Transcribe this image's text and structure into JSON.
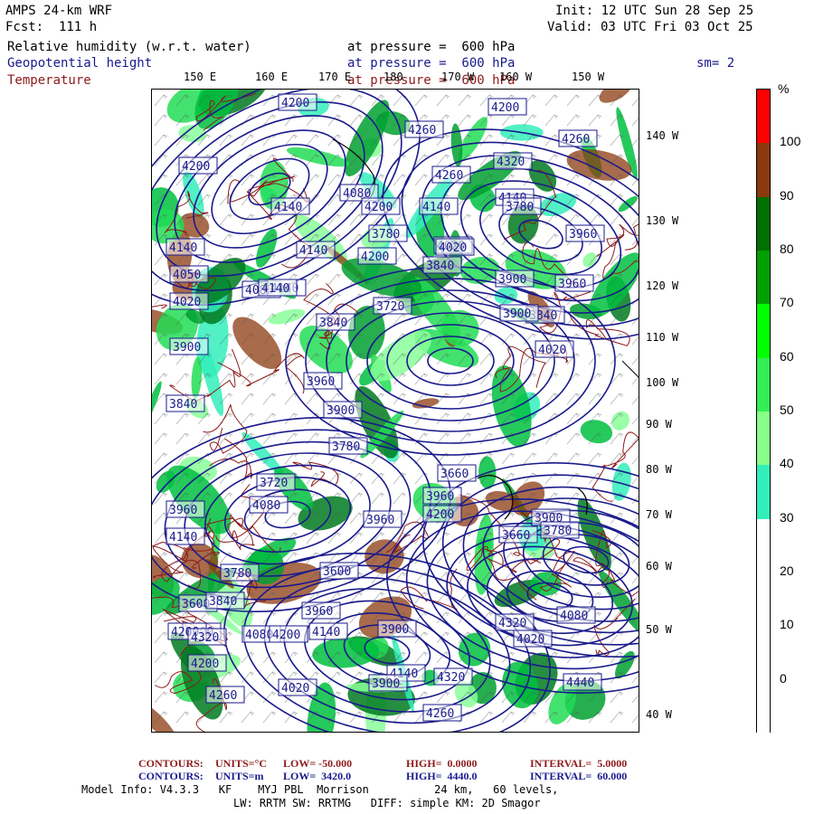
{
  "header": {
    "model": "AMPS 24-km WRF",
    "fcst": "Fcst:  111 h",
    "init": "Init: 12 UTC Sun 28 Sep 25",
    "valid": "Valid: 03 UTC Fri 03 Oct 25",
    "fields": [
      {
        "name": "Relative humidity (w.r.t. water)",
        "level": "at pressure =  600 hPa",
        "color": "#000000"
      },
      {
        "name": "Geopotential height",
        "level": "at pressure =  600 hPa",
        "color": "#1a1a8c"
      },
      {
        "name": "Temperature",
        "level": "at pressure =  600 hPa",
        "color": "#8c1a1a"
      }
    ],
    "smooth": "sm= 2"
  },
  "map": {
    "lon_labels": [
      "150 E",
      "160 E",
      "170 E",
      "180",
      "170 W",
      "160 W",
      "150 W"
    ],
    "lat_labels": [
      "140 W",
      "130 W",
      "120 W",
      "110 W",
      "100 W",
      "90 W",
      "80 W",
      "70 W",
      "60 W",
      "50 W",
      "40 W"
    ],
    "height_labels": [
      "4200",
      "4260",
      "4200",
      "4260",
      "4200",
      "4080",
      "4260",
      "4320",
      "4140",
      "4200",
      "4140",
      "4140",
      "3960",
      "4050",
      "4200",
      "3780",
      "4020",
      "4080",
      "3780",
      "3840",
      "4140",
      "4140",
      "4140",
      "3900",
      "3960",
      "4020",
      "3840",
      "3900",
      "4140",
      "4020",
      "3720",
      "3900",
      "4020",
      "3840",
      "3960",
      "3840",
      "3900",
      "3720",
      "3780",
      "3660",
      "3960",
      "3960",
      "4080",
      "4140",
      "3600",
      "3960",
      "3660",
      "3600",
      "3780",
      "3900",
      "3780",
      "4200",
      "3840",
      "4080",
      "4320",
      "4020",
      "3900",
      "4200",
      "4140",
      "4020",
      "3900",
      "3960",
      "4200",
      "4200",
      "4260",
      "4320",
      "4260",
      "4200",
      "4320",
      "4140",
      "4080",
      "4440"
    ]
  },
  "colorbar": {
    "unit": "%",
    "ticks": [
      "100",
      "90",
      "80",
      "70",
      "60",
      "50",
      "40",
      "30",
      "20",
      "10",
      "0"
    ],
    "colors": [
      "#ff0000",
      "#8b3a0f",
      "#007000",
      "#00a000",
      "#00ff00",
      "#33ee55",
      "#88ff88",
      "#33eebb",
      "#ffffff",
      "#ffffff",
      "#ffffff",
      "#ffffff"
    ]
  },
  "footer": {
    "line1": {
      "label": "CONTOURS:",
      "units": "UNITS=°C",
      "low": "LOW= -50.000",
      "high": "HIGH=  0.0000",
      "interval": "INTERVAL=  5.0000"
    },
    "line2": {
      "label": "CONTOURS:",
      "units": "UNITS=m",
      "low": "LOW=  3420.0",
      "high": "HIGH=  4440.0",
      "interval": "INTERVAL=  60.000"
    },
    "line3": "Model Info: V4.3.3   KF    MYJ PBL  Morrison          24 km,   60 levels,",
    "line4": "LW: RRTM SW: RRTMG   DIFF: simple KM: 2D Smagor"
  }
}
